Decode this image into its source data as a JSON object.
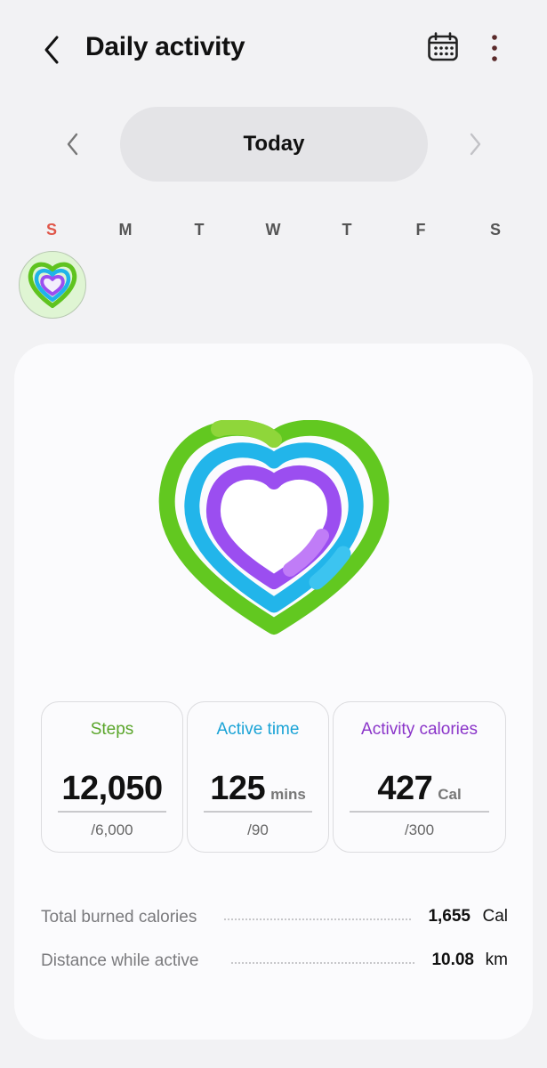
{
  "header": {
    "title": "Daily activity",
    "back_icon": "chevron-left-icon",
    "calendar_icon": "calendar-icon",
    "more_icon": "more-vertical-icon"
  },
  "date_nav": {
    "label": "Today",
    "prev_icon": "chevron-left-icon",
    "next_icon": "chevron-right-icon"
  },
  "week": {
    "days": [
      "S",
      "M",
      "T",
      "W",
      "T",
      "F",
      "S"
    ],
    "accent_sunday": "#e0574a"
  },
  "rings": {
    "steps_color": "#62c820",
    "active_color": "#22b5ea",
    "calories_color": "#9b4ef0"
  },
  "stats": [
    {
      "label": "Steps",
      "value": "12,050",
      "unit": "",
      "goal": "/6,000",
      "color": "#5aa52a"
    },
    {
      "label": "Active time",
      "value": "125",
      "unit": "mins",
      "goal": "/90",
      "color": "#1aa3d6"
    },
    {
      "label": "Activity calories",
      "value": "427",
      "unit": "Cal",
      "goal": "/300",
      "color": "#8a34c9"
    }
  ],
  "summary": [
    {
      "label": "Total burned calories",
      "value": "1,655",
      "unit": "Cal"
    },
    {
      "label": "Distance while active",
      "value": "10.08",
      "unit": "km"
    }
  ]
}
